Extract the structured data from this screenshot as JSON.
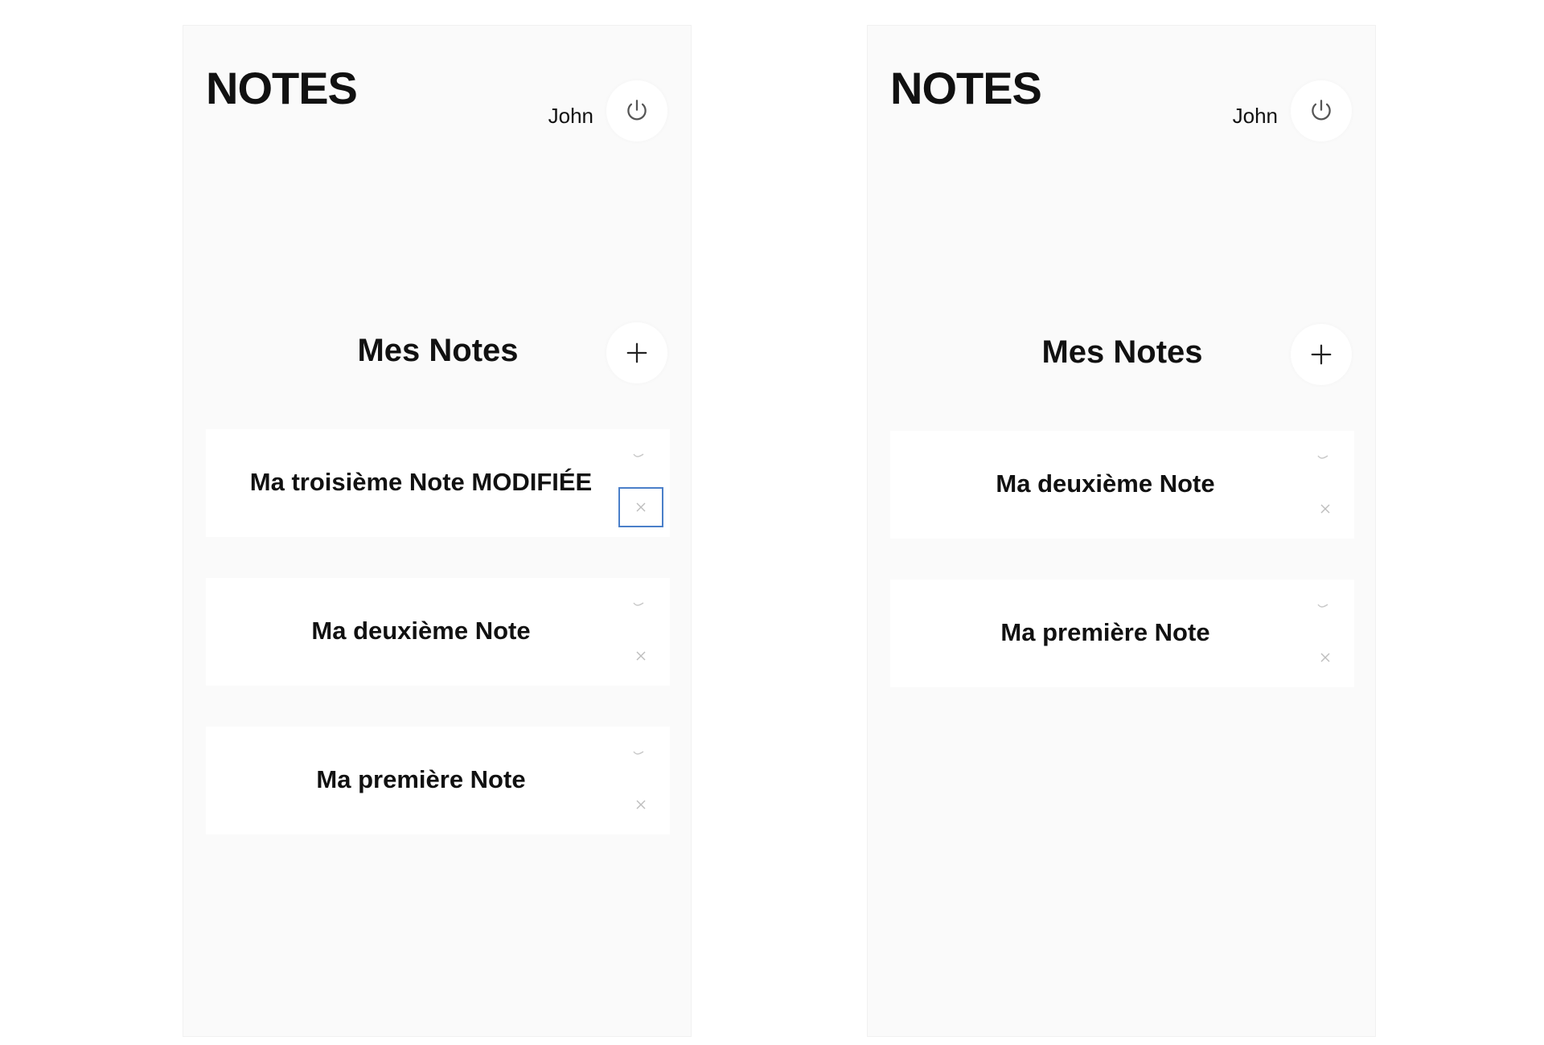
{
  "panels": [
    {
      "header": {
        "app_title": "NOTES",
        "user_name": "John"
      },
      "section_title": "Mes Notes",
      "notes": [
        {
          "title": "Ma troisième Note MODIFIÉE"
        },
        {
          "title": "Ma deuxième Note"
        },
        {
          "title": "Ma première Note"
        }
      ]
    },
    {
      "header": {
        "app_title": "NOTES",
        "user_name": "John"
      },
      "section_title": "Mes Notes",
      "notes": [
        {
          "title": "Ma deuxième Note"
        },
        {
          "title": "Ma première Note"
        }
      ]
    }
  ],
  "icons": {
    "logout": "power-icon",
    "add": "plus-icon",
    "expand": "chevron-down-icon",
    "delete": "close-icon"
  },
  "colors": {
    "panel_bg": "#fafafa",
    "card_bg": "#ffffff",
    "text": "#111111",
    "muted_icon": "#c8c8c8",
    "focus_ring": "#4a7fc9"
  }
}
